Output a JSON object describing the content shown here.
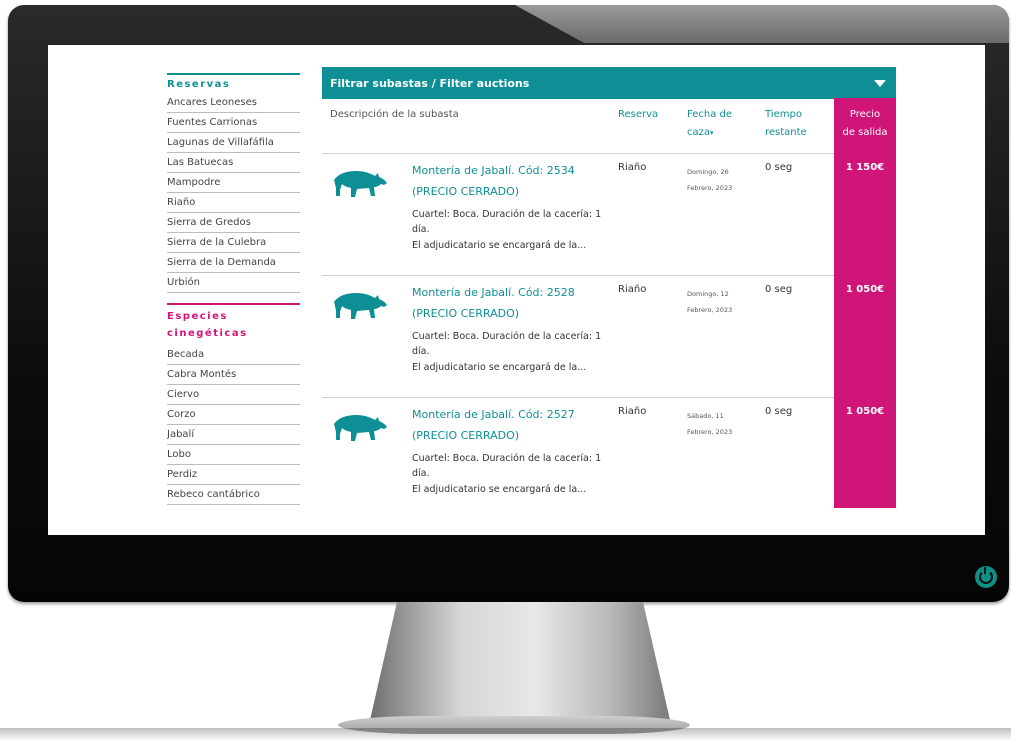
{
  "sidebar": {
    "reservas": {
      "title": "Reservas",
      "items": [
        "Ancares Leoneses",
        "Fuentes Carrionas",
        "Lagunas de Villafáfila",
        "Las Batuecas",
        "Mampodre",
        "Riaño",
        "Sierra de Gredos",
        "Sierra de la Culebra",
        "Sierra de la Demanda",
        "Urbión"
      ]
    },
    "especies": {
      "title_line1": "Especies",
      "title_line2": "cinegéticas",
      "items": [
        "Becada",
        "Cabra Montés",
        "Ciervo",
        "Corzo",
        "Jabalí",
        "Lobo",
        "Perdiz",
        "Rebeco cantábrico"
      ]
    }
  },
  "filter": {
    "label": "Filtrar subastas / Filter auctions"
  },
  "table": {
    "headers": {
      "descripcion": "Descripción de la subasta",
      "reserva": "Reserva",
      "fecha_line1": "Fecha de",
      "fecha_line2": "caza",
      "tiempo_line1": "Tiempo",
      "tiempo_line2": "restante",
      "precio_line1": "Precio",
      "precio_line2": "de salida"
    },
    "rows": [
      {
        "title_line1": "Montería de Jabalí. Cód: 2534",
        "title_line2": "(PRECIO CERRADO)",
        "desc_line1": "Cuartel: Boca. Duración de la cacería: 1",
        "desc_line1b": "día.",
        "desc_line2": "El adjudicatario se encargará de la...",
        "reserva": "Riaño",
        "fecha_line1": "Domingo, 26",
        "fecha_line2": "Febrero, 2023",
        "tiempo": "0 seg",
        "precio": "1 150€"
      },
      {
        "title_line1": "Montería de Jabalí. Cód: 2528",
        "title_line2": "(PRECIO CERRADO)",
        "desc_line1": "Cuartel: Boca. Duración de la cacería: 1",
        "desc_line1b": "día.",
        "desc_line2": "El adjudicatario se encargará de la...",
        "reserva": "Riaño",
        "fecha_line1": "Domingo, 12",
        "fecha_line2": "Febrero, 2023",
        "tiempo": "0 seg",
        "precio": "1 050€"
      },
      {
        "title_line1": "Montería de Jabalí. Cód: 2527",
        "title_line2": "(PRECIO CERRADO)",
        "desc_line1": "Cuartel: Boca. Duración de la cacería: 1",
        "desc_line1b": "día.",
        "desc_line2": "El adjudicatario se encargará de la...",
        "reserva": "Riaño",
        "fecha_line1": "Sábado, 11",
        "fecha_line2": "Febrero, 2023",
        "tiempo": "0 seg",
        "precio": "1 050€"
      }
    ]
  },
  "colors": {
    "teal": "#0e8f96",
    "magenta": "#cf1578"
  },
  "icons": {
    "row_icon": "boar-icon",
    "filter_toggle": "caret-down-icon",
    "power": "power-icon"
  }
}
